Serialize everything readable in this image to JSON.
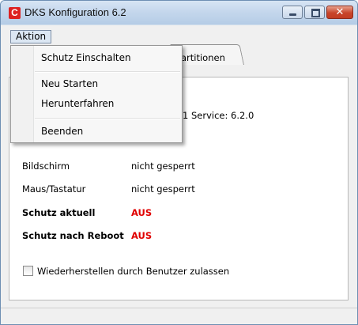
{
  "window": {
    "app_icon_letter": "C",
    "title": "DKS Konfiguration 6.2",
    "close_glyph": "✕"
  },
  "menubar": {
    "aktion_label": "Aktion"
  },
  "aktion_menu": {
    "items": [
      {
        "label": "Schutz Einschalten"
      },
      {
        "label": "Neu Starten"
      },
      {
        "label": "Herunterfahren"
      },
      {
        "label": "Beenden"
      }
    ]
  },
  "tabs": {
    "partitionen_visible_label": "artitionen"
  },
  "panel": {
    "service_visible_text": "1   Service: 6.2.0",
    "rows": [
      {
        "label": "Bildschirm",
        "value": "nicht gesperrt"
      },
      {
        "label": "Maus/Tastatur",
        "value": "nicht gesperrt"
      },
      {
        "label": "Schutz aktuell",
        "value": "AUS"
      },
      {
        "label": "Schutz nach Reboot",
        "value": "AUS"
      }
    ],
    "restore_checkbox_label": "Wiederherstellen durch Benutzer zulassen",
    "restore_checkbox_checked": false
  },
  "colors": {
    "status_off": "#e00000",
    "app_icon": "#dd2222"
  }
}
